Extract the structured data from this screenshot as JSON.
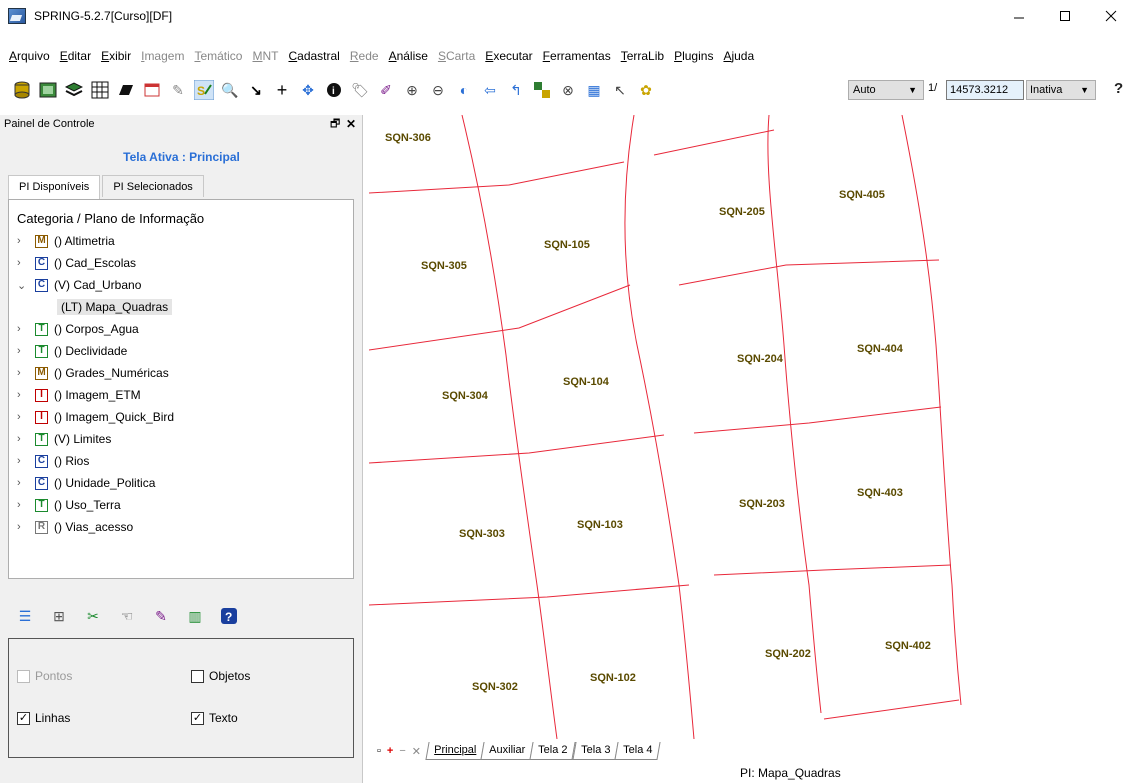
{
  "window": {
    "title": "SPRING-5.2.7[Curso][DF]",
    "minimize_icon": "minimize-icon",
    "maximize_icon": "maximize-icon",
    "close_icon": "close-icon"
  },
  "menu": [
    {
      "label": "Arquivo",
      "enabled": true
    },
    {
      "label": "Editar",
      "enabled": true
    },
    {
      "label": "Exibir",
      "enabled": true
    },
    {
      "label": "Imagem",
      "enabled": false
    },
    {
      "label": "Temático",
      "enabled": false
    },
    {
      "label": "MNT",
      "enabled": false
    },
    {
      "label": "Cadastral",
      "enabled": true
    },
    {
      "label": "Rede",
      "enabled": false
    },
    {
      "label": "Análise",
      "enabled": true
    },
    {
      "label": "SCarta",
      "enabled": false
    },
    {
      "label": "Executar",
      "enabled": true
    },
    {
      "label": "Ferramentas",
      "enabled": true
    },
    {
      "label": "TerraLib",
      "enabled": true
    },
    {
      "label": "Plugins",
      "enabled": true
    },
    {
      "label": "Ajuda",
      "enabled": true
    }
  ],
  "toolbar": {
    "zoom_mode": "Auto",
    "scale_prefix": "1/",
    "scale_value": "14573.3212",
    "status": "Inativa"
  },
  "panel": {
    "title": "Painel de Controle",
    "active_screen": "Tela Ativa : Principal",
    "tabs": [
      "PI Disponíveis",
      "PI Selecionados"
    ],
    "tree_header": "Categoria / Plano de Informação",
    "categories": [
      {
        "type": "M",
        "label": "() Altimetria",
        "expanded": false
      },
      {
        "type": "C",
        "label": "() Cad_Escolas",
        "expanded": false
      },
      {
        "type": "C",
        "label": "(V) Cad_Urbano",
        "expanded": true
      },
      {
        "type": "T",
        "label": "() Corpos_Agua",
        "expanded": false
      },
      {
        "type": "T",
        "label": "() Declividade",
        "expanded": false
      },
      {
        "type": "M",
        "label": "() Grades_Numéricas",
        "expanded": false
      },
      {
        "type": "I",
        "label": "() Imagem_ETM",
        "expanded": false
      },
      {
        "type": "I",
        "label": "() Imagem_Quick_Bird",
        "expanded": false
      },
      {
        "type": "T",
        "label": "(V) Limites",
        "expanded": false
      },
      {
        "type": "C",
        "label": "() Rios",
        "expanded": false
      },
      {
        "type": "C",
        "label": "() Unidade_Politica",
        "expanded": false
      },
      {
        "type": "T",
        "label": "() Uso_Terra",
        "expanded": false
      },
      {
        "type": "R",
        "label": "() Vias_acesso",
        "expanded": false
      }
    ],
    "child_item": "(LT) Mapa_Quadras",
    "draw_options": {
      "pontos": {
        "label": "Pontos",
        "checked": false,
        "enabled": false
      },
      "objetos": {
        "label": "Objetos",
        "checked": false,
        "enabled": true
      },
      "linhas": {
        "label": "Linhas",
        "checked": true,
        "enabled": true
      },
      "texto": {
        "label": "Texto",
        "checked": true,
        "enabled": true
      }
    }
  },
  "map": {
    "line_color": "#e8283a",
    "label_color": "#5a4a00",
    "labels": [
      {
        "text": "SQN-306"
      },
      {
        "text": "SQN-305"
      },
      {
        "text": "SQN-105"
      },
      {
        "text": "SQN-205"
      },
      {
        "text": "SQN-405"
      },
      {
        "text": "SQN-304"
      },
      {
        "text": "SQN-104"
      },
      {
        "text": "SQN-204"
      },
      {
        "text": "SQN-404"
      },
      {
        "text": "SQN-303"
      },
      {
        "text": "SQN-103"
      },
      {
        "text": "SQN-203"
      },
      {
        "text": "SQN-403"
      },
      {
        "text": "SQN-302"
      },
      {
        "text": "SQN-102"
      },
      {
        "text": "SQN-202"
      },
      {
        "text": "SQN-402"
      }
    ]
  },
  "bottom_tabs": [
    "Principal",
    "Auxiliar",
    "Tela 2",
    "Tela 3",
    "Tela 4"
  ],
  "status_bar": {
    "text": "PI: Mapa_Quadras"
  }
}
